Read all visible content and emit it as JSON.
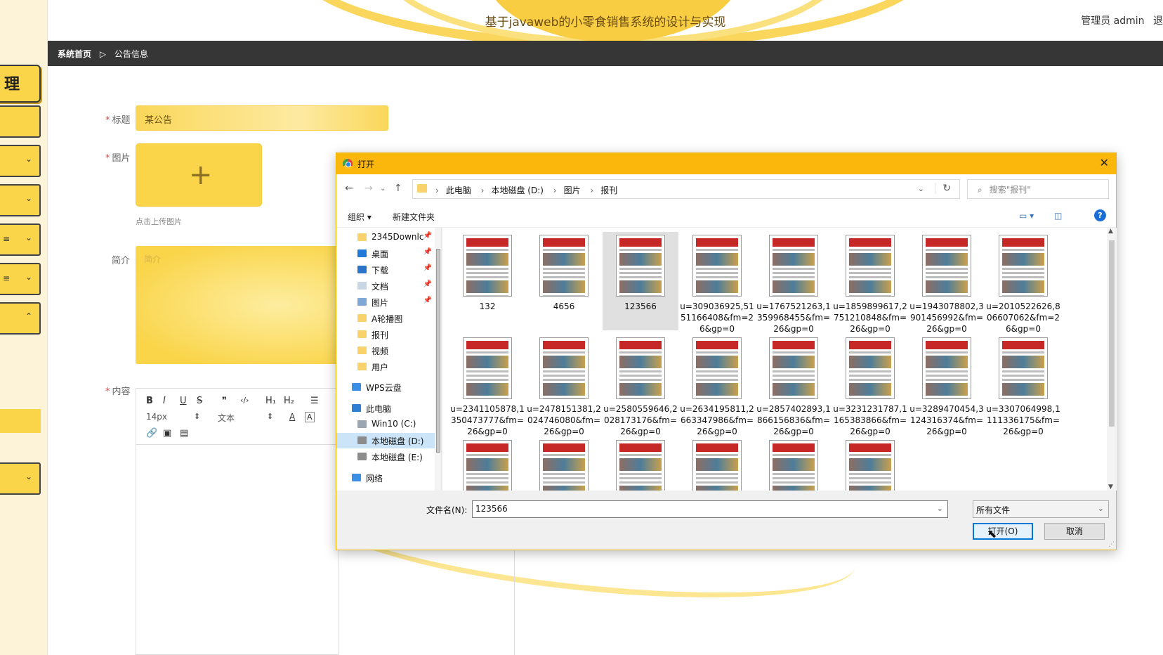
{
  "header": {
    "title": "基于javaweb的小零食销售系统的设计与实现",
    "user": "管理员 admin",
    "logout_partial": "退"
  },
  "sidebar": {
    "logo_char": "理"
  },
  "breadcrumb": {
    "home": "系统首页",
    "sep": "▷",
    "current": "公告信息"
  },
  "form": {
    "title_label": "标题",
    "title_value": "某公告",
    "image_label": "图片",
    "upload_tip": "点击上传图片",
    "brief_label": "简介",
    "brief_placeholder": "简介",
    "content_label": "内容",
    "editor": {
      "bold": "B",
      "italic": "I",
      "underline": "U",
      "strike": "S",
      "quote": "❞",
      "code": "‹/›",
      "h1": "H₁",
      "h2": "H₂",
      "list": "☰",
      "font_size": "14px",
      "font_size_arrow": "⇕",
      "text_style": "文本",
      "text_style_arrow": "⇕",
      "font_color": "A",
      "bg_color": "A"
    }
  },
  "dialog": {
    "title": "打开",
    "close": "✕",
    "path": [
      "此电脑",
      "本地磁盘 (D:)",
      "图片",
      "报刊"
    ],
    "search_placeholder": "搜索\"报刊\"",
    "organize": "组织 ▾",
    "new_folder": "新建文件夹",
    "help": "?",
    "nav_items": [
      {
        "label": "2345Downlc",
        "pinned": true,
        "color": "#f8d26b"
      },
      {
        "label": "桌面",
        "pinned": true,
        "color": "#1f7ad8"
      },
      {
        "label": "下载",
        "pinned": true,
        "color": "#2b74c9"
      },
      {
        "label": "文档",
        "pinned": true,
        "color": "#c9d6e6"
      },
      {
        "label": "图片",
        "pinned": true,
        "color": "#7fa8d6"
      },
      {
        "label": "A轮播图",
        "pinned": false,
        "color": "#f8d26b"
      },
      {
        "label": "报刊",
        "pinned": false,
        "color": "#f8d26b"
      },
      {
        "label": "视频",
        "pinned": false,
        "color": "#f8d26b"
      },
      {
        "label": "用户",
        "pinned": false,
        "color": "#f8d26b"
      },
      {
        "label": "WPS云盘",
        "pinned": false,
        "color": "#3b8ee6"
      },
      {
        "label": "此电脑",
        "pinned": false,
        "color": "#2d7fd1"
      },
      {
        "label": "Win10 (C:)",
        "pinned": false,
        "color": "#9aa6b2"
      },
      {
        "label": "本地磁盘 (D:)",
        "pinned": false,
        "color": "#8c8c8c"
      },
      {
        "label": "本地磁盘 (E:)",
        "pinned": false,
        "color": "#8c8c8c"
      },
      {
        "label": "网络",
        "pinned": false,
        "color": "#3b8ee6"
      }
    ],
    "files": [
      "132",
      "4656",
      "123566",
      "u=309036925,5151166408&fm=26&gp=0",
      "u=1767521263,1359968455&fm=26&gp=0",
      "u=1859899617,2751210848&fm=26&gp=0",
      "u=1943078802,3901456992&fm=26&gp=0",
      "u=2010522626,806607062&fm=26&gp=0",
      "u=2341105878,1350473777&fm=26&gp=0",
      "u=2478151381,2024746080&fm=26&gp=0",
      "u=2580559646,2028173176&fm=26&gp=0",
      "u=2634195811,2663347986&fm=26&gp=0",
      "u=2857402893,1866156836&fm=26&gp=0",
      "u=3231231787,1165383866&fm=26&gp=0",
      "u=3289470454,3124316374&fm=26&gp=0",
      "u=3307064998,1111336175&fm=26&gp=0",
      "",
      "",
      "",
      "",
      "",
      ""
    ],
    "selected_file": "123566",
    "filename_label": "文件名(N):",
    "filename_value": "123566",
    "filetype": "所有文件",
    "open_button": "打开(O)",
    "cancel_button": "取消"
  }
}
